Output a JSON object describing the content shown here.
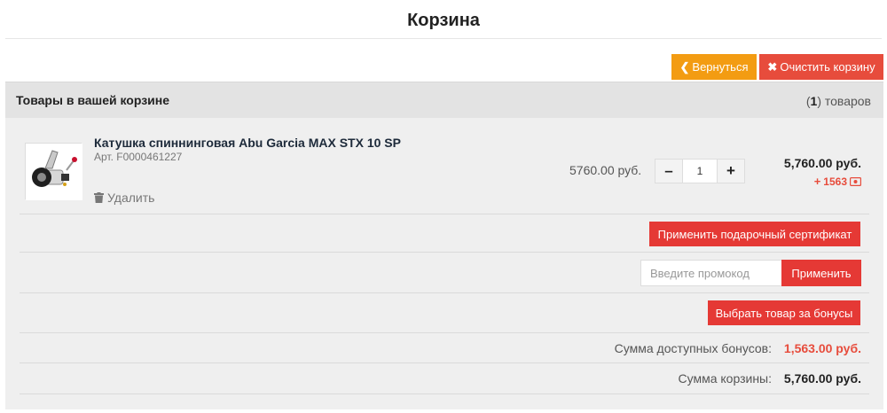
{
  "page": {
    "title": "Корзина"
  },
  "actions": {
    "back_label": "Вернуться",
    "back_icon": "chevron-left-icon",
    "clear_label": "Очистить корзину",
    "clear_icon": "close-icon"
  },
  "cart": {
    "header_title": "Товары в вашей корзине",
    "count": "1",
    "count_unit": "товаров",
    "items": [
      {
        "name": "Катушка спиннинговая Abu Garcia MAX STX 10 SP",
        "sku": "Арт. F0000461227",
        "delete_label": "Удалить",
        "unit_price": "5760.00 руб.",
        "quantity": "1",
        "total": "5,760.00 руб.",
        "bonus": "1563"
      }
    ]
  },
  "gift_certificate_label": "Применить подарочный сертификат",
  "promo": {
    "placeholder": "Введите промокод",
    "apply_label": "Применить"
  },
  "bonus_select_label": "Выбрать товар за бонусы",
  "summary": {
    "bonus_label": "Сумма доступных бонусов:",
    "bonus_value": "1,563.00 руб.",
    "cart_label": "Сумма корзины:",
    "cart_value": "5,760.00 руб."
  },
  "colors": {
    "back_button": "#f39c12",
    "clear_button": "#e74c3c",
    "action_button": "#e53935",
    "bonus_text": "#e74c3c"
  }
}
